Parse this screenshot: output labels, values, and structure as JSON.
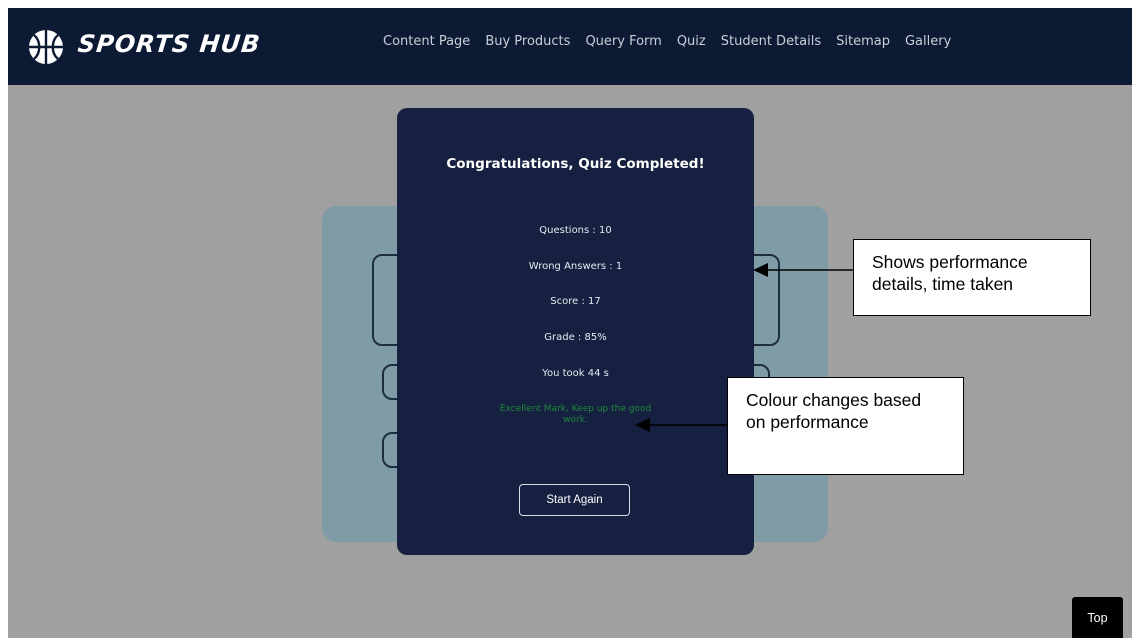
{
  "brand": {
    "name": "SPORTS HUB",
    "logo_icon": "basketball-icon"
  },
  "nav": {
    "links": [
      "Content Page",
      "Buy Products",
      "Query Form",
      "Quiz",
      "Student Details",
      "Sitemap",
      "Gallery"
    ]
  },
  "modal": {
    "title": "Congratulations, Quiz Completed!",
    "questions": "Questions : 10",
    "wrong_answers": "Wrong Answers : 1",
    "score": "Score : 17",
    "grade": "Grade : 85%",
    "time_taken": "You took 44 s",
    "feedback": "Excellent Mark, Keep up the good work.",
    "feedback_color": "#1f8a3a",
    "start_again_label": "Start Again"
  },
  "annotations": {
    "performance": "Shows performance details, time taken",
    "colour": "Colour changes based on performance"
  },
  "top_button_label": "Top",
  "colors": {
    "navbar": "#0d1a33",
    "modal": "#162040",
    "overlay": "#a0a0a0",
    "quiz_card": "#7f9ca6"
  }
}
